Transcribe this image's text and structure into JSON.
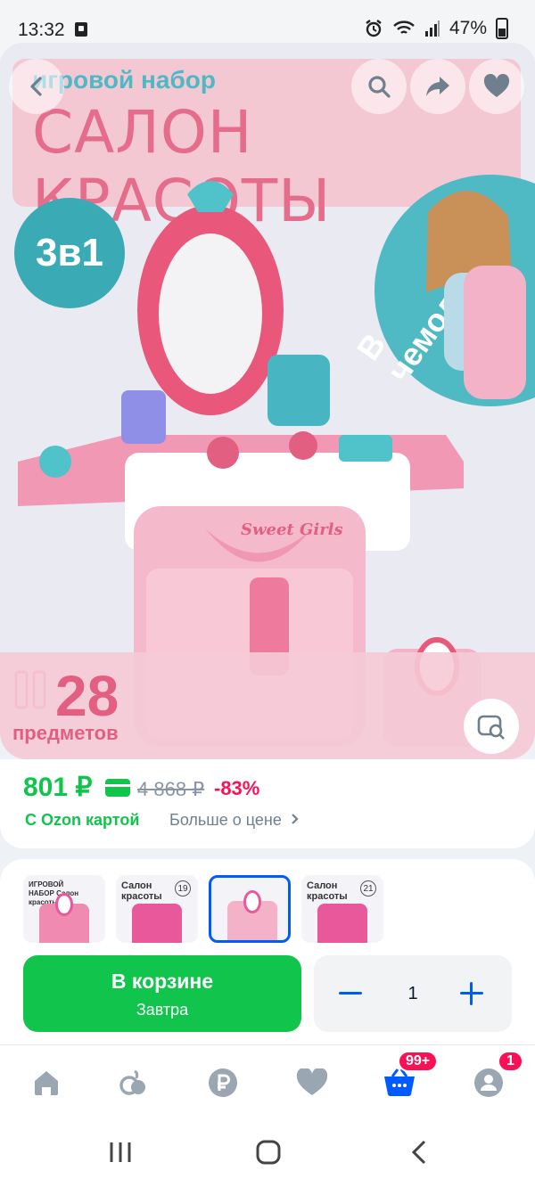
{
  "status_bar": {
    "time": "13:32",
    "battery": "47%"
  },
  "hero": {
    "subtitle": "игровой набор",
    "title": "САЛОН КРАСОТЫ",
    "badge_3in1": "3в1",
    "in_case": "В чемодане",
    "count": "28",
    "count_label": "предметов",
    "sign": "Sweet Girls"
  },
  "header_buttons": [
    "back-icon",
    "search-icon",
    "share-icon",
    "heart-icon"
  ],
  "price": {
    "current": "801 ₽",
    "old": "4 868 ₽",
    "discount": "-83%",
    "ozon_card": "С Ozon картой",
    "more": "Больше о цене",
    "accent": "#10c44c"
  },
  "thumbnails": [
    {
      "title": "ИГРОВОЙ НАБОР Салон красоты",
      "badge": ""
    },
    {
      "title": "Салон красоты",
      "badge": "19"
    },
    {
      "title": "",
      "badge": "",
      "selected": true
    },
    {
      "title": "Салон красоты",
      "badge": "21"
    }
  ],
  "cart": {
    "label": "В корзине",
    "delivery": "Завтра",
    "quantity": "1"
  },
  "bottom_nav": {
    "items": [
      "home-icon",
      "fresh-icon",
      "ruble-icon",
      "favorites-icon",
      "cart-icon",
      "profile-icon"
    ],
    "cart_badge": "99+",
    "profile_badge": "1"
  }
}
